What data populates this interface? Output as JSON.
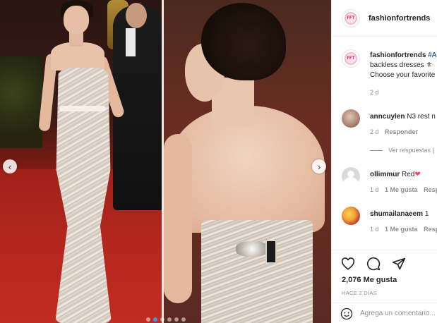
{
  "post": {
    "account": "fashionfortrends",
    "caption": {
      "username": "fashionfortrends",
      "tag": "#A",
      "line2": "backless dresses ⚜",
      "line3": "Choose your favorite",
      "time": "2 d"
    },
    "comments": [
      {
        "username": "anncuylen",
        "text": "N3 rest n",
        "time": "2 d",
        "reply": "Responder",
        "view_replies": "Ver respuestas ("
      },
      {
        "username": "ollimmur",
        "text": "Red",
        "emoji": "❤",
        "time": "1 d",
        "likes": "1 Me gusta",
        "reply": "Responder"
      },
      {
        "username": "shumailanaeem",
        "text": "1",
        "time": "1 d",
        "likes": "1 Me gusta",
        "reply": "Responder"
      }
    ],
    "like_count": "2,076 Me gusta",
    "posted": "HACE 2 DÍAS",
    "comment_placeholder": "Agrega un comentario..."
  },
  "carousel": {
    "prev_symbol": "‹",
    "next_symbol": "›",
    "dots": 6,
    "active_dot": 1
  },
  "colors": {
    "accent": "#3897f0",
    "like_red": "#ed4956",
    "muted": "#8e8e8e",
    "text": "#262626"
  },
  "icons": [
    "heart-icon",
    "comment-icon",
    "share-icon",
    "emoji-icon",
    "chevron-left-icon",
    "chevron-right-icon"
  ]
}
